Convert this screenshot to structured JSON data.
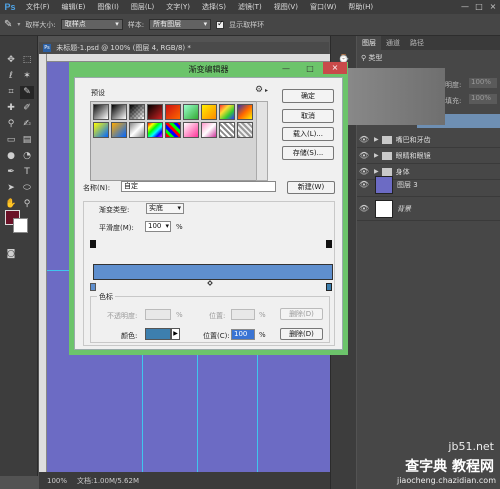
{
  "menubar": {
    "logo": "Ps",
    "items": [
      "文件(F)",
      "编辑(E)",
      "图像(I)",
      "图层(L)",
      "文字(Y)",
      "选择(S)",
      "滤镜(T)",
      "视图(V)",
      "窗口(W)",
      "帮助(H)"
    ],
    "win_controls": [
      "—",
      "□",
      "×"
    ]
  },
  "options": {
    "sample_size_label": "取样大小:",
    "sample_size_value": "取样点",
    "sample_label": "样本:",
    "sample_value": "所有图层",
    "show_ring_label": "显示取样环",
    "show_ring_checked": true
  },
  "document": {
    "tab_title": "未标题-1.psd @ 100% (图层 4, RGB/8) *",
    "zoom": "100%",
    "doc_info": "文档:1.00M/5.62M",
    "canvas_color": "#6c6bc4"
  },
  "colors": {
    "foreground": "#6b1227",
    "background": "#ffffff"
  },
  "layers_panel": {
    "tabs": [
      "图层",
      "通道",
      "路径"
    ],
    "kind_label": "类型",
    "opacity_label": "明度:",
    "fill_label": "填充:",
    "opacity_value": "100%",
    "fill_value": "100%",
    "layers": [
      {
        "name": "嘴巴和牙齿",
        "type": "group"
      },
      {
        "name": "眼睛和眼镜",
        "type": "group"
      },
      {
        "name": "身体",
        "type": "group"
      },
      {
        "name": "图层 3",
        "type": "layer",
        "thumb_color": "#6c6bc4"
      },
      {
        "name": "背景",
        "type": "layer",
        "thumb_color": "#ffffff"
      }
    ]
  },
  "gradient_editor": {
    "title": "渐变编辑器",
    "presets_label": "预设",
    "gear_icon": "gear-icon",
    "buttons": {
      "ok": "确定",
      "cancel": "取消",
      "load": "载入(L)...",
      "save": "存储(S)...",
      "new": "新建(W)"
    },
    "name_label": "名称(N):",
    "name_value": "自定",
    "gradient_type_label": "渐变类型:",
    "gradient_type_value": "实底",
    "smoothness_label": "平滑度(M):",
    "smoothness_value": "100",
    "percent": "%",
    "stops_legend": "色标",
    "opacity_label": "不透明度:",
    "location_label": "位置:",
    "delete_label": "删除(D)",
    "color_label": "颜色:",
    "color_location_label": "位置(C):",
    "color_location_value": "100",
    "stop_color": "#3d7fae",
    "gradient_color": "#5f8fce"
  },
  "status_bar": {
    "zoom": "100%",
    "doc": "文档:1.00M/5.62M"
  },
  "watermark": {
    "line1": "查字典",
    "line2": "教程网",
    "line3": "jiaocheng.chazidian.com",
    "site": "jb51.net"
  }
}
